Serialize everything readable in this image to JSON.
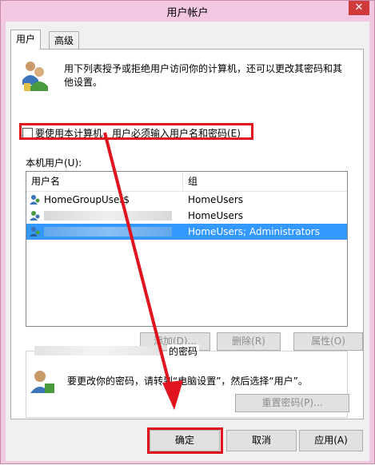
{
  "window": {
    "title": "用户帐户",
    "close_glyph": "✕"
  },
  "tabs": [
    {
      "label": "用户"
    },
    {
      "label": "高级"
    }
  ],
  "description": "用下列表授予或拒绝用户访问你的计算机，还可以更改其密码和其他设置。",
  "checkbox": {
    "label": "要使用本计算机，用户必须输入用户名和密码(E)",
    "checked": false
  },
  "users_label": "本机用户(U):",
  "list": {
    "columns": [
      "用户名",
      "组"
    ],
    "rows": [
      {
        "name": "HomeGroupUser$",
        "group": "HomeUsers",
        "selected": false
      },
      {
        "name": "",
        "group": "HomeUsers",
        "selected": false
      },
      {
        "name": "",
        "group": "HomeUsers; Administrators",
        "selected": true
      }
    ]
  },
  "buttons": {
    "add": "添加(D)...",
    "remove": "删除(R)",
    "properties": "属性(O)"
  },
  "password_group": {
    "title_suffix": "的密码",
    "instruction": "要更改你的密码，请转到“电脑设置”，然后选择“用户”。",
    "reset_button": "重置密码(P)..."
  },
  "dialog_buttons": {
    "ok": "确定",
    "cancel": "取消",
    "apply": "应用(A)"
  },
  "colors": {
    "annotation_red": "#e0141e",
    "selection_blue": "#3399ff",
    "title_pink": "#f3c7e2"
  },
  "icons": [
    "users-icon",
    "user-row-icon",
    "password-user-icon",
    "close-icon"
  ]
}
